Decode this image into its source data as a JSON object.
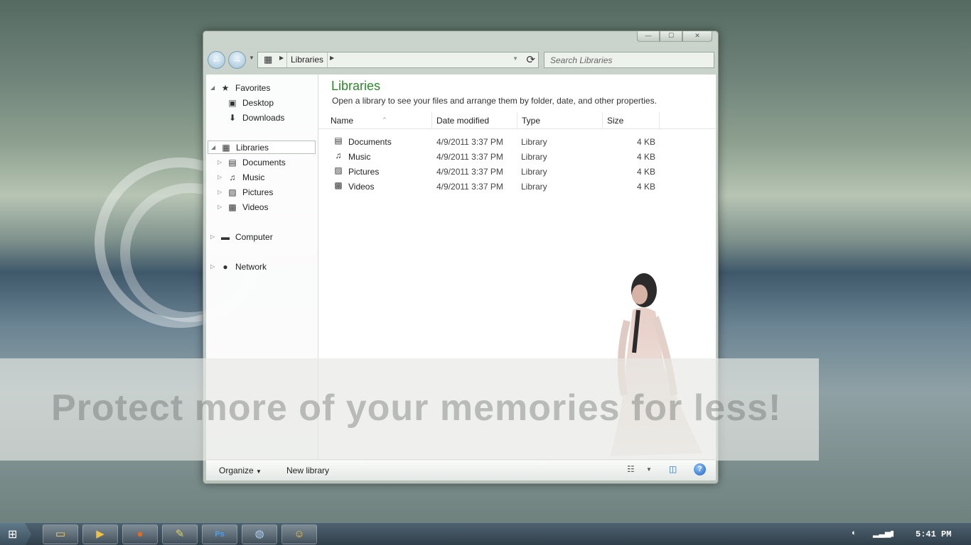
{
  "explorer": {
    "address": {
      "crumb": "Libraries"
    },
    "search": {
      "placeholder": "Search Libraries"
    },
    "nav": {
      "favorites_label": "Favorites",
      "favorites": [
        "Desktop",
        "Downloads"
      ],
      "libraries_label": "Libraries",
      "libraries": [
        "Documents",
        "Music",
        "Pictures",
        "Videos"
      ],
      "computer_label": "Computer",
      "network_label": "Network"
    },
    "content": {
      "title": "Libraries",
      "subtitle": "Open a library to see your files and arrange them by folder, date, and other properties.",
      "columns": [
        "Name",
        "Date modified",
        "Type",
        "Size"
      ],
      "rows": [
        {
          "name": "Documents",
          "date": "4/9/2011 3:37 PM",
          "type": "Library",
          "size": "4 KB"
        },
        {
          "name": "Music",
          "date": "4/9/2011 3:37 PM",
          "type": "Library",
          "size": "4 KB"
        },
        {
          "name": "Pictures",
          "date": "4/9/2011 3:37 PM",
          "type": "Library",
          "size": "4 KB"
        },
        {
          "name": "Videos",
          "date": "4/9/2011 3:37 PM",
          "type": "Library",
          "size": "4 KB"
        }
      ]
    },
    "commands": {
      "organize": "Organize",
      "new_library": "New library",
      "help": "?"
    }
  },
  "watermark": {
    "text": "Protect more of your memories for less!"
  },
  "taskbar": {
    "clock": "5:41 PM"
  },
  "colors": {
    "title_green": "#2a8a2a",
    "accent_blue": "#1f5fbf"
  }
}
